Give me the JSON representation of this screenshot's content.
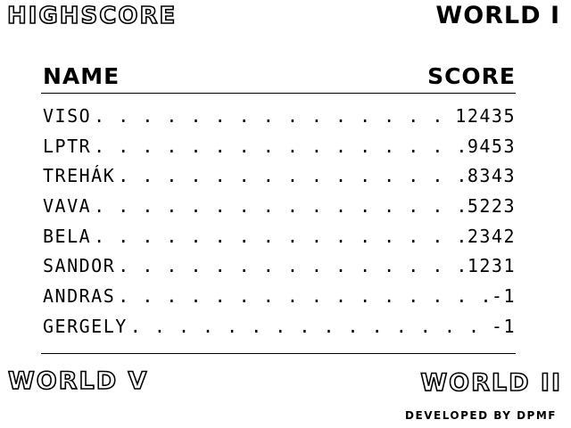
{
  "header": {
    "title": "HIGHSCORE",
    "world_current": "WORLD I"
  },
  "table": {
    "columns": [
      "NAME",
      "SCORE"
    ],
    "rows": [
      {
        "name": "VISO",
        "score": "12435"
      },
      {
        "name": "LPTR",
        "score": "9453"
      },
      {
        "name": "TREHÁK",
        "score": "8343"
      },
      {
        "name": "VAVA",
        "score": "5223"
      },
      {
        "name": "BELA",
        "score": "2342"
      },
      {
        "name": "SANDOR",
        "score": "1231"
      },
      {
        "name": "ANDRAS",
        "score": "-1"
      },
      {
        "name": "GERGELY",
        "score": "-1"
      }
    ]
  },
  "footer": {
    "world_prev": "WORLD V",
    "world_next": "WORLD II",
    "credits": "DEVELOPED BY DPMF"
  },
  "colors": {
    "background": "#ffffff",
    "foreground": "#000000"
  }
}
